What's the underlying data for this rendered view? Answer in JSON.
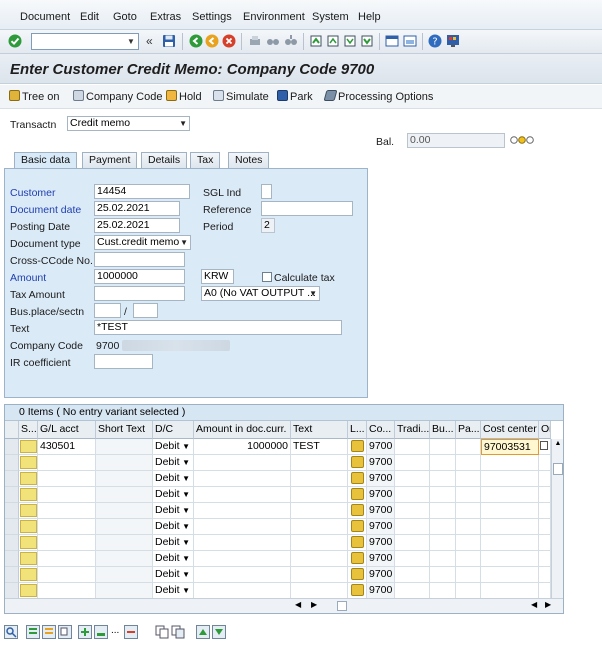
{
  "menu": [
    "Document",
    "Edit",
    "Goto",
    "Extras",
    "Settings",
    "Environment",
    "System",
    "Help"
  ],
  "title": "Enter Customer Credit Memo: Company Code 9700",
  "app_toolbar": {
    "tree_on": "Tree on",
    "company_code": "Company Code",
    "hold": "Hold",
    "simulate": "Simulate",
    "park": "Park",
    "processing_options": "Processing Options"
  },
  "header": {
    "transaction_label": "Transactn",
    "transaction_value": "Credit memo",
    "balance_label": "Bal.",
    "balance_value": "0.00"
  },
  "tabs": [
    "Basic data",
    "Payment",
    "Details",
    "Tax",
    "Notes"
  ],
  "form": {
    "customer_label": "Customer",
    "customer_value": "14454",
    "sgl_label": "SGL Ind",
    "sgl_value": "",
    "doc_date_label": "Document date",
    "doc_date_value": "25.02.2021",
    "reference_label": "Reference",
    "reference_value": "",
    "posting_date_label": "Posting Date",
    "posting_date_value": "25.02.2021",
    "period_label": "Period",
    "period_value": "2",
    "doc_type_label": "Document type",
    "doc_type_value": "Cust.credit memo",
    "cross_cc_label": "Cross-CCode No.",
    "cross_cc_value": "",
    "amount_label": "Amount",
    "amount_value": "1000000",
    "currency_value": "KRW",
    "calc_tax_label": "Calculate tax",
    "tax_amount_label": "Tax Amount",
    "tax_amount_value": "",
    "tax_code_value": "A0 (No VAT OUTPUT ...",
    "bus_place_label": "Bus.place/sectn",
    "slash": "/",
    "text_label": "Text",
    "text_value": "*TEST",
    "company_code_label": "Company Code",
    "company_code_value": "9700",
    "ir_coeff_label": "IR coefficient",
    "ir_coeff_value": ""
  },
  "grid": {
    "title": "0 Items ( No entry variant selected )",
    "columns": [
      "S...",
      "G/L acct",
      "Short Text",
      "D/C",
      "Amount in doc.curr.",
      "Text",
      "L...",
      "Co...",
      "Tradi...",
      "Bu...",
      "Pa...",
      "Cost center",
      "Or"
    ],
    "first_row": {
      "gl_acct": "430501",
      "short_text": "",
      "dc": "Debit",
      "amount": "1000000",
      "text": "TEST",
      "co": "9700",
      "cost_center": "97003531"
    },
    "empty_rows": [
      {
        "dc": "Debit",
        "co": "9700"
      },
      {
        "dc": "Debit",
        "co": "9700"
      },
      {
        "dc": "Debit",
        "co": "9700"
      },
      {
        "dc": "Debit",
        "co": "9700"
      },
      {
        "dc": "Debit",
        "co": "9700"
      },
      {
        "dc": "Debit",
        "co": "9700"
      },
      {
        "dc": "Debit",
        "co": "9700"
      },
      {
        "dc": "Debit",
        "co": "9700"
      },
      {
        "dc": "Debit",
        "co": "9700"
      }
    ]
  },
  "colors": {
    "required_label": "#1f3fb0",
    "panel_bg": "#dbeaf7",
    "status_yellow": "#f2e27a"
  }
}
